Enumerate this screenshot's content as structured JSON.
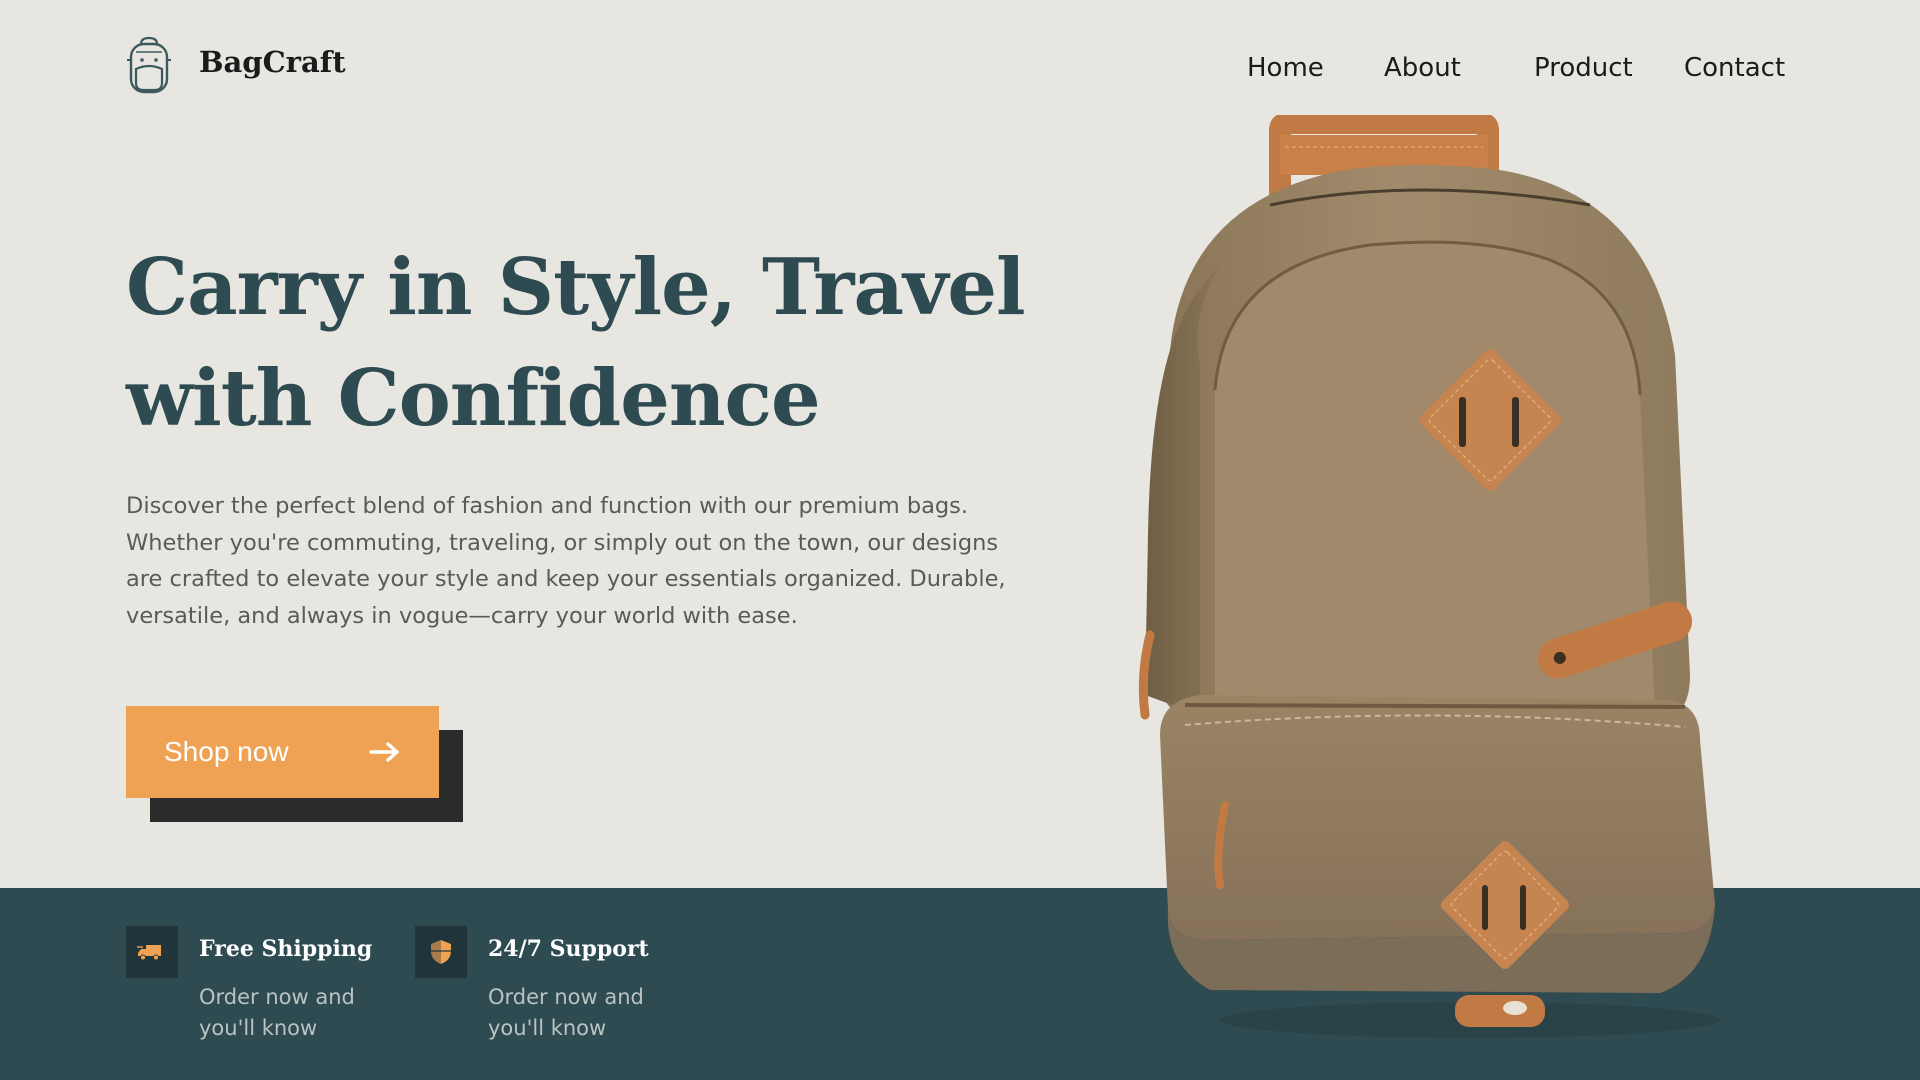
{
  "brand": {
    "name": "BagCraft"
  },
  "nav": {
    "items": [
      {
        "label": "Home"
      },
      {
        "label": "About"
      },
      {
        "label": "Product"
      },
      {
        "label": "Contact"
      }
    ]
  },
  "hero": {
    "title": "Carry in Style, Travel with Confidence",
    "description": "Discover the perfect blend of fashion and function with our premium bags. Whether you're commuting, traveling, or simply out on the town, our designs are crafted to elevate your style and keep your essentials organized. Durable, versatile, and always in vogue—carry your world with ease.",
    "cta_label": "Shop now"
  },
  "features": [
    {
      "icon": "truck-icon",
      "title": "Free Shipping",
      "text": "Order now and you'll know"
    },
    {
      "icon": "shield-icon",
      "title": "24/7 Support",
      "text": "Order now and you'll know"
    }
  ],
  "colors": {
    "background": "#e8e6e1",
    "title": "#2f4b52",
    "accent": "#f0a254",
    "band": "#2f4b52",
    "button_shadow": "#2a2b2b"
  }
}
